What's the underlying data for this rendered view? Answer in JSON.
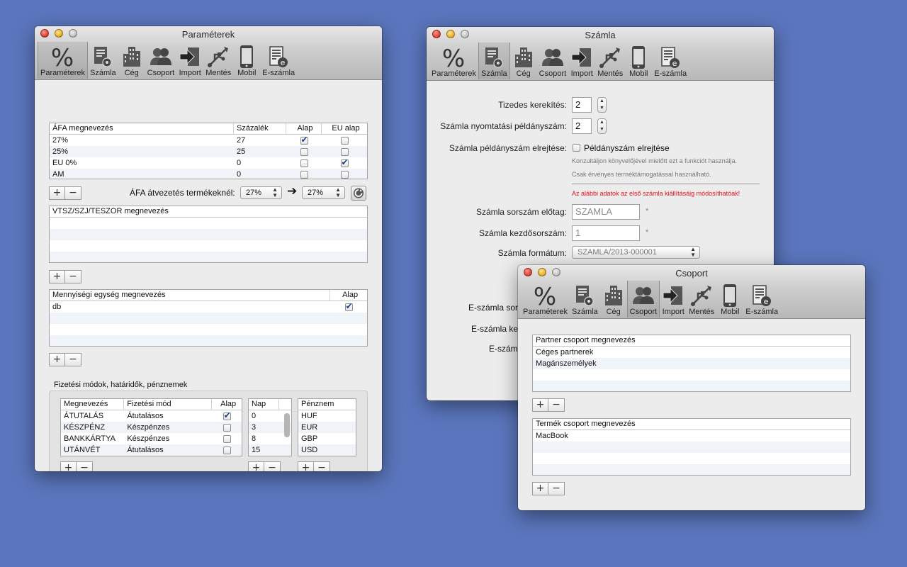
{
  "toolbar_labels": [
    "Paraméterek",
    "Számla",
    "Cég",
    "Csoport",
    "Import",
    "Mentés",
    "Mobil",
    "E-számla"
  ],
  "icons": [
    "percent-icon",
    "invoice-gear-icon",
    "building-icon",
    "group-icon",
    "import-icon",
    "usb-icon",
    "mobile-icon",
    "e-invoice-icon"
  ],
  "win1": {
    "title": "Paraméterek",
    "vat_table": {
      "headers": [
        "ÁFA megnevezés",
        "Százalék",
        "Alap",
        "EU alap"
      ],
      "rows": [
        {
          "name": "27%",
          "pct": "27",
          "alap": true,
          "eu": false
        },
        {
          "name": "25%",
          "pct": "25",
          "alap": false,
          "eu": false
        },
        {
          "name": "EU 0%",
          "pct": "0",
          "alap": false,
          "eu": true
        },
        {
          "name": "AM",
          "pct": "0",
          "alap": false,
          "eu": false
        }
      ]
    },
    "vat_transfer_label": "ÁFA átvezetés termékeknél:",
    "vat_from": "27%",
    "vat_to": "27%",
    "vtsz_header": "VTSZ/SZJ/TESZOR megnevezés",
    "unit_table": {
      "headers": [
        "Mennyiségi egység megnevezés",
        "Alap"
      ],
      "rows": [
        {
          "name": "db",
          "alap": true
        }
      ]
    },
    "payment_group_title": "Fizetési módok, határidők, pénznemek",
    "payment_table": {
      "headers": [
        "Megnevezés",
        "Fizetési mód",
        "Alap"
      ],
      "rows": [
        {
          "name": "ÁTUTALÁS",
          "mode": "Átutalásos",
          "alap": true
        },
        {
          "name": "KÉSZPÉNZ",
          "mode": "Készpénzes",
          "alap": false
        },
        {
          "name": "BANKKÁRTYA",
          "mode": "Készpénzes",
          "alap": false
        },
        {
          "name": "UTÁNVÉT",
          "mode": "Átutalásos",
          "alap": false
        }
      ]
    },
    "days_table": {
      "header": "Nap",
      "rows": [
        "0",
        "3",
        "8",
        "15"
      ]
    },
    "currency_table": {
      "header": "Pénznem",
      "rows": [
        "HUF",
        "EUR",
        "GBP",
        "USD"
      ]
    }
  },
  "win2": {
    "title": "Számla",
    "decimal_label": "Tizedes kerekítés:",
    "decimal_value": "2",
    "copies_label": "Számla nyomtatási példányszám:",
    "copies_value": "2",
    "hide_label": "Számla példányszám elrejtése:",
    "hide_checkbox_label": "Példányszám elrejtése",
    "hint1": "Konzultáljon könyvelőjével mielőtt ezt a funkciót használja.",
    "hint2": "Csak érvényes terméktámogatással használható.",
    "warning": "Az alábbi adatok az első számla kiállításáig módosíthatóak!",
    "prefix_label": "Számla sorszám előtag:",
    "prefix_value": "SZAMLA",
    "start_label": "Számla kezdősorszám:",
    "start_value": "1",
    "format_label": "Számla formátum:",
    "format_value": "SZAMLA/2013-000001",
    "asterisk": "*",
    "e1_label": "E-számla sor",
    "e2_label": "E-számla ke",
    "e3_label": "E-szám"
  },
  "win3": {
    "title": "Csoport",
    "partner_header": "Partner csoport megnevezés",
    "partner_rows": [
      "Céges partnerek",
      "Magánszemélyek"
    ],
    "product_header": "Termék csoport megnevezés",
    "product_rows": [
      "MacBook"
    ]
  },
  "buttons": {
    "plus": "+",
    "minus": "−"
  },
  "colors": {
    "desktop": "#5b76bd",
    "warning": "#e01020",
    "check": "#1b3d8f"
  }
}
